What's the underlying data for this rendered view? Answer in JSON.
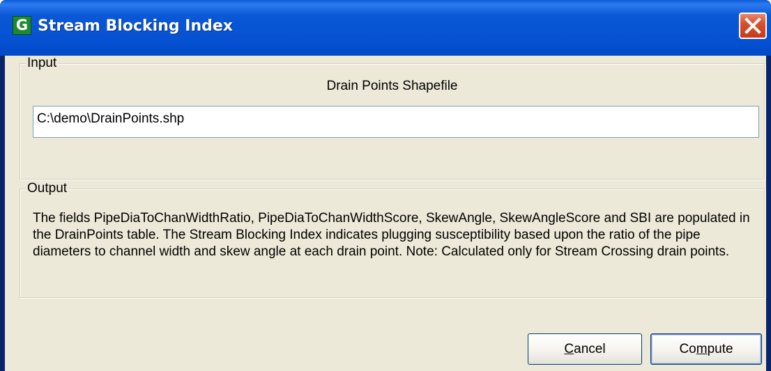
{
  "window": {
    "title": "Stream Blocking Index",
    "app_icon_letter": "G"
  },
  "input": {
    "group_label": "Input",
    "field_label": "Drain Points Shapefile",
    "path_value": "C:\\demo\\DrainPoints.shp"
  },
  "output": {
    "group_label": "Output",
    "description": "The fields PipeDiaToChanWidthRatio, PipeDiaToChanWidthScore, SkewAngle, SkewAngleScore and SBI are populated in the DrainPoints table. The Stream Blocking Index indicates plugging susceptibility based upon the ratio of the pipe diameters to channel width and skew angle at each drain point. Note: Calculated only for Stream Crossing drain points."
  },
  "buttons": {
    "cancel_hotkey": "C",
    "cancel_rest": "ancel",
    "compute_start": "Co",
    "compute_hotkey": "m",
    "compute_rest": "pute"
  },
  "icons": {
    "app": "app-g-icon",
    "close": "close-x-icon"
  },
  "colors": {
    "titlebar": "#0551d2",
    "dialog_face": "#ece9d8",
    "close_button": "#d8512e",
    "app_icon": "#1e8a2e"
  }
}
